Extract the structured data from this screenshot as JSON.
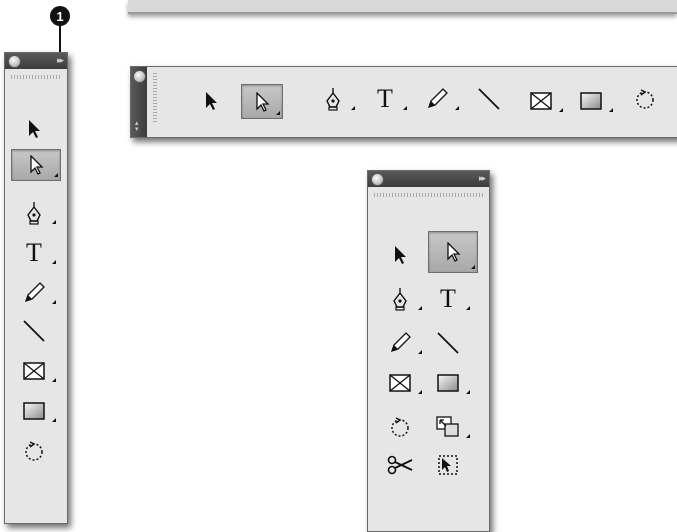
{
  "callout": {
    "number": "1"
  },
  "panels": {
    "single_column": {
      "collapse_icon": "double-arrow-right-icon"
    },
    "horizontal": {
      "collapse_icon": "double-arrow-vertical-icon"
    },
    "double_column": {
      "collapse_icon": "double-arrow-right-icon"
    }
  },
  "tools": {
    "type_label": "T"
  },
  "colors": {
    "panel_bg": "#e6e6e6",
    "titlebar": "#4a4a4a",
    "selected_tool": "#b8b8b8"
  }
}
